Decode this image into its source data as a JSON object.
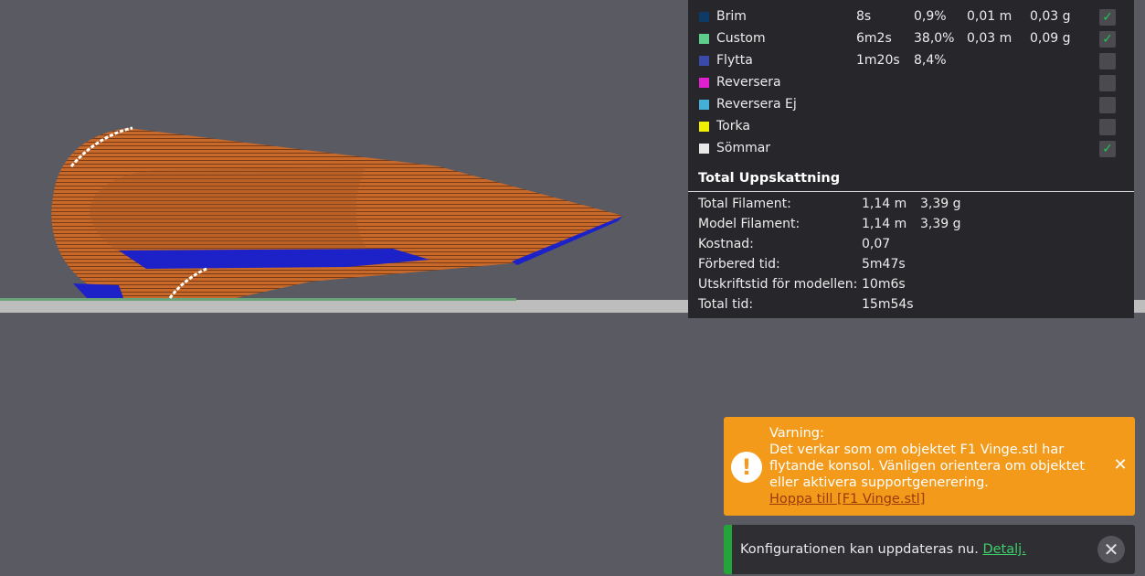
{
  "legend": {
    "rows": [
      {
        "name": "Brim",
        "time": "8s",
        "percent": "0,9%",
        "length": "0,01 m",
        "weight": "0,03 g",
        "color": "#0d3b66",
        "checked": true
      },
      {
        "name": "Custom",
        "time": "6m2s",
        "percent": "38,0%",
        "length": "0,03 m",
        "weight": "0,09 g",
        "color": "#5ecf8a",
        "checked": true
      },
      {
        "name": "Flytta",
        "time": "1m20s",
        "percent": "8,4%",
        "length": "",
        "weight": "",
        "color": "#3a4aa8",
        "checked": false
      },
      {
        "name": "Reversera",
        "time": "",
        "percent": "",
        "length": "",
        "weight": "",
        "color": "#e020d0",
        "checked": false
      },
      {
        "name": "Reversera Ej",
        "time": "",
        "percent": "",
        "length": "",
        "weight": "",
        "color": "#44b0d8",
        "checked": false
      },
      {
        "name": "Torka",
        "time": "",
        "percent": "",
        "length": "",
        "weight": "",
        "color": "#f0f000",
        "checked": false
      },
      {
        "name": "Sömmar",
        "time": "",
        "percent": "",
        "length": "",
        "weight": "",
        "color": "#e8e8e8",
        "checked": true
      }
    ],
    "check_glyph": "✓"
  },
  "totals": {
    "header": "Total Uppskattning",
    "rows": [
      {
        "label": "Total Filament:",
        "v1": "1,14 m",
        "v2": "3,39 g"
      },
      {
        "label": "Model Filament:",
        "v1": "1,14 m",
        "v2": "3,39 g"
      },
      {
        "label": "Kostnad:",
        "v1": "0,07",
        "v2": ""
      },
      {
        "label": "Förbered tid:",
        "v1": "5m47s",
        "v2": ""
      },
      {
        "label": "Utskriftstid för modellen:",
        "v1": "10m6s",
        "v2": ""
      },
      {
        "label": "Total tid:",
        "v1": "15m54s",
        "v2": ""
      }
    ]
  },
  "warning": {
    "title": "Varning:",
    "message": "Det verkar som om objektet F1 Vinge.stl har flytande konsol. Vänligen orientera om objektet eller aktivera supportgenerering.",
    "link": "Hoppa till [F1 Vinge.stl]",
    "icon_glyph": "!",
    "close_glyph": "✕",
    "color": "#f39a1a"
  },
  "notification": {
    "message": "Konfigurationen kan uppdateras nu.",
    "link": "Detalj.",
    "close_glyph": "✕",
    "accent": "#22a63a"
  },
  "colors": {
    "background": "#5a5a62",
    "model": "#c0662c",
    "support": "#1c22c8",
    "seam": "#ffffff",
    "bed": "#bcbcbc"
  }
}
